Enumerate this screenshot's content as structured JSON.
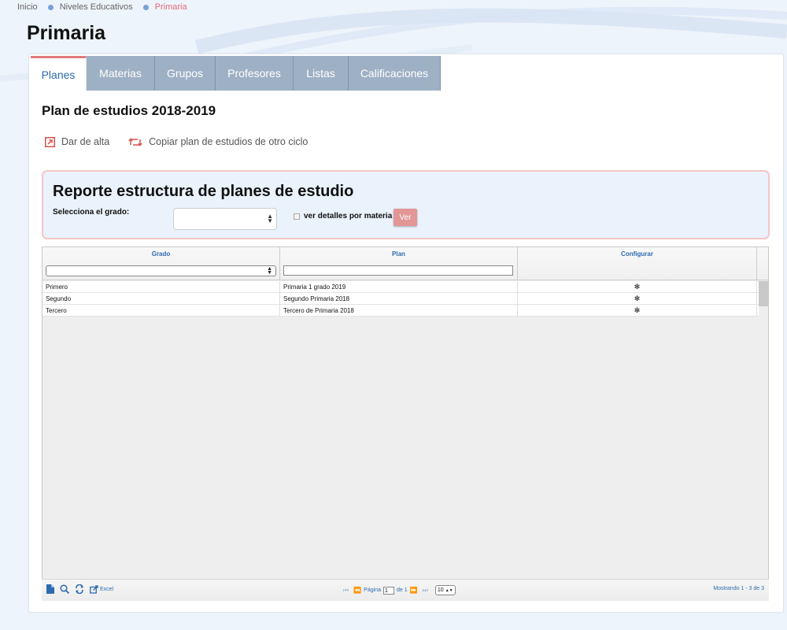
{
  "breadcrumb": {
    "items": [
      "Inicio",
      "Niveles Educativos"
    ],
    "current": "Primaria"
  },
  "page": {
    "title": "Primaria"
  },
  "tabs": [
    {
      "label": "Planes",
      "active": true
    },
    {
      "label": "Materias",
      "active": false
    },
    {
      "label": "Grupos",
      "active": false
    },
    {
      "label": "Profesores",
      "active": false
    },
    {
      "label": "Listas",
      "active": false
    },
    {
      "label": "Calificaciones",
      "active": false
    }
  ],
  "plan": {
    "title": "Plan de estudios 2018-2019",
    "actions": {
      "add_label": "Dar de alta",
      "copy_label": "Copiar plan de estudios de otro ciclo"
    }
  },
  "report": {
    "title": "Reporte estructura de planes de estudio",
    "grade_label": "Selecciona el grado:",
    "grade_value": "",
    "details_label": "ver detalles por materia",
    "details_checked": false,
    "ver_label": "Ver"
  },
  "grid": {
    "columns": [
      "Grado",
      "Plan",
      "Configurar"
    ],
    "filter_plan_value": "",
    "rows": [
      {
        "grado": "Primero",
        "plan": "Primaria 1 grado 2019"
      },
      {
        "grado": "Segundo",
        "plan": "Segundo Primaria 2018"
      },
      {
        "grado": "Tercero",
        "plan": "Tercero de Primaria 2018"
      }
    ]
  },
  "pager": {
    "excel_label": "Excel",
    "page_label": "Página",
    "page_value": "1",
    "of_label": "de 1",
    "rows_per_page": "10",
    "summary": "Mostrando 1 - 3 de 3"
  },
  "colors": {
    "accent": "#2d6bb0",
    "tab_inactive": "#9eb0c4",
    "highlight": "#e06a78",
    "button": "#e29696"
  }
}
